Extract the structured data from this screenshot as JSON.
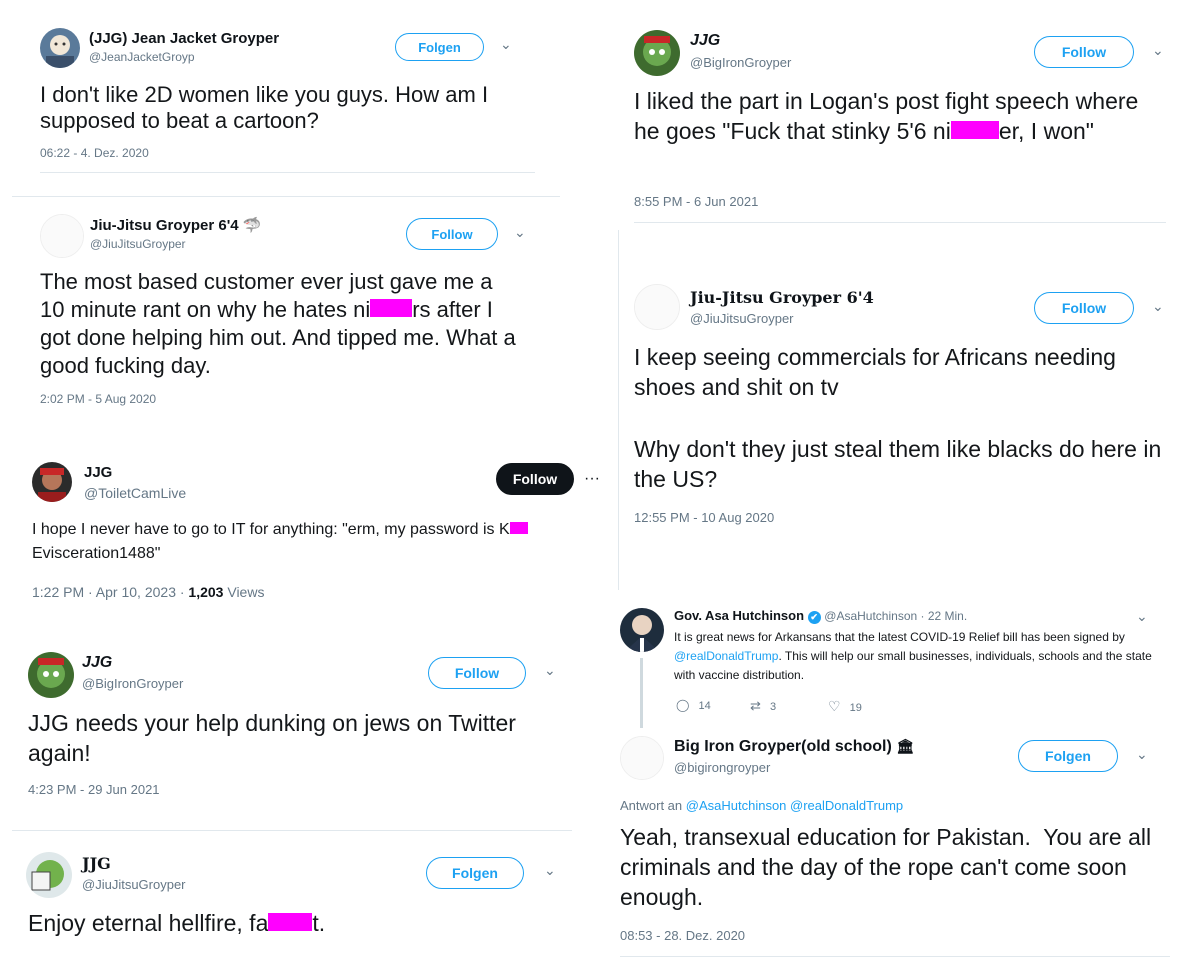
{
  "tweets": {
    "t1": {
      "name": "(JJG) Jean Jacket Groyper",
      "handle": "@JeanJacketGroyp",
      "button": "Folgen",
      "text": "I don't like 2D women like you guys. How am I supposed to beat a cartoon?",
      "time": "06:22 - 4. Dez. 2020"
    },
    "t2": {
      "name": "Jiu-Jitsu Groyper 6'4",
      "name_emoji": "🦈",
      "handle": "@JiuJitsuGroyper",
      "button": "Follow",
      "text_a": "The most based customer ever just gave me a 10 minute rant on why he hates ni",
      "text_b": "rs after I got done helping him out. And tipped me. What a good fucking day.",
      "time": "2:02 PM - 5 Aug 2020"
    },
    "t3": {
      "name": "JJG",
      "handle": "@ToiletCamLive",
      "button": "Follow",
      "more": "···",
      "text_a": "I hope I never have to go to IT for anything: \"erm, my password is K",
      "text_b": "Evisceration1488\"",
      "time": "1:22 PM · Apr 10, 2023 · ",
      "views_count": "1,203",
      "views_label": " Views"
    },
    "t4": {
      "name": "JJG",
      "handle": "@BigIronGroyper",
      "button": "Follow",
      "text": "JJG needs your help dunking on jews on Twitter again!",
      "time": "4:23 PM - 29 Jun 2021"
    },
    "t5": {
      "name": "JJG",
      "handle": "@JiuJitsuGroyper",
      "button": "Folgen",
      "text_a": "Enjoy eternal hellfire, fa",
      "text_b": "t.",
      "time": ""
    },
    "t6": {
      "name": "JJG",
      "handle": "@BigIronGroyper",
      "button": "Follow",
      "text_a": "I liked the part in Logan's post fight speech where he goes \"Fuck that stinky 5'6 ni",
      "text_b": "er, I won\"",
      "time": "8:55 PM - 6 Jun 2021"
    },
    "t7": {
      "name": "Jiu-Jitsu Groyper 6'4",
      "handle": "@JiuJitsuGroyper",
      "button": "Follow",
      "text_p1": "I keep seeing commercials for Africans needing shoes and shit on tv",
      "text_p2": "Why don't they just steal them like blacks do here in the US?",
      "time": "12:55 PM - 10 Aug 2020"
    },
    "t8": {
      "name": "Gov. Asa Hutchinson",
      "verified": "✔",
      "handle": "@AsaHutchinson · 22 Min.",
      "text_a": "It is great news for Arkansans that the latest COVID-19 Relief bill has been signed by ",
      "mention": "@realDonaldTrump",
      "text_b": ". This will help our small businesses, individuals, schools and the state with vaccine distribution.",
      "replies": "14",
      "retweets": "3",
      "likes": "19"
    },
    "t9": {
      "name": "Big Iron Groyper(old school)",
      "name_emoji": "🏛",
      "handle": "@bigirongroyper",
      "button": "Folgen",
      "reply_prefix": "Antwort an ",
      "reply_to": "@AsaHutchinson @realDonaldTrump",
      "text": "Yeah, transexual education for Pakistan.  You are all criminals and the day of the rope can't come soon enough.",
      "time": "08:53 - 28. Dez. 2020"
    }
  },
  "icons": {
    "chevron": "⌄",
    "reply": "◯",
    "retweet": "⇄",
    "like": "♡"
  },
  "colors": {
    "link": "#1da1f2",
    "censor": "#ff00ff",
    "muted": "#657786"
  }
}
